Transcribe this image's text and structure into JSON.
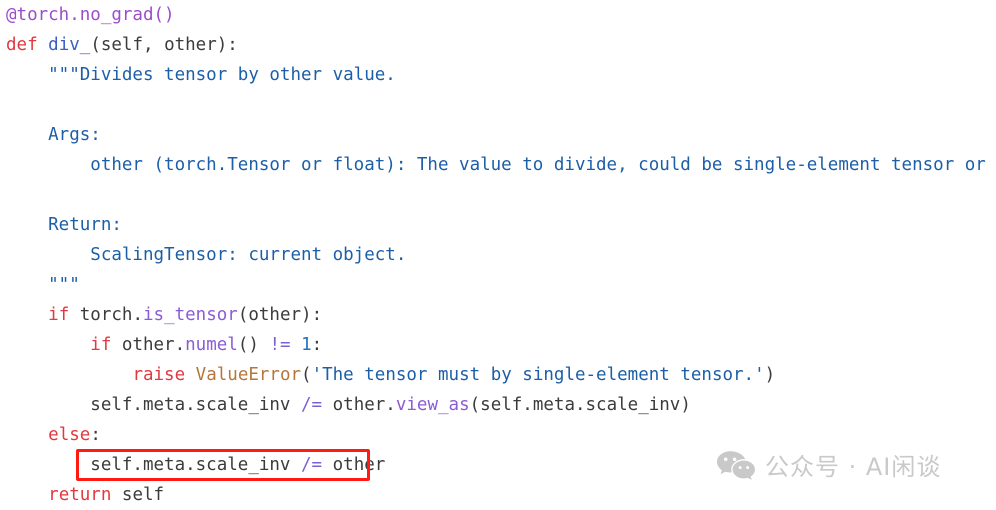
{
  "code": {
    "language": "python",
    "background_color": "#ffffff",
    "colors": {
      "plain": "#3b3b3b",
      "keyword": "#e2383f",
      "decorator": "#9b4dca",
      "function": "#3b5fc0",
      "method": "#8a5cd6",
      "operator": "#7a5fd6",
      "string": "#1c5fa8",
      "docstring": "#1c5fa8",
      "exception": "#b5763a",
      "number": "#2a6fc0"
    },
    "lines": [
      {
        "index": 1,
        "text": "@torch.no_grad()",
        "tokens": [
          {
            "t": "@torch.no_grad()",
            "c": "decorator"
          }
        ]
      },
      {
        "index": 2,
        "text": "def div_(self, other):",
        "tokens": [
          {
            "t": "def",
            "c": "keyword"
          },
          {
            "t": " ",
            "c": "plain"
          },
          {
            "t": "div_",
            "c": "func"
          },
          {
            "t": "(self, other):",
            "c": "plain"
          }
        ]
      },
      {
        "index": 3,
        "text": "    \"\"\"Divides tensor by other value.",
        "tokens": [
          {
            "t": "    \"\"\"Divides tensor by other value.",
            "c": "docstring"
          }
        ]
      },
      {
        "index": 4,
        "text": "",
        "tokens": []
      },
      {
        "index": 5,
        "text": "    Args:",
        "tokens": [
          {
            "t": "    Args:",
            "c": "docstring"
          }
        ]
      },
      {
        "index": 6,
        "text": "        other (torch.Tensor or float): The value to divide, could be single-element tensor or float.",
        "tokens": [
          {
            "t": "        other (torch.Tensor or float): The value to divide, could be single-element tensor or float.",
            "c": "docstring"
          }
        ]
      },
      {
        "index": 7,
        "text": "",
        "tokens": []
      },
      {
        "index": 8,
        "text": "    Return:",
        "tokens": [
          {
            "t": "    Return:",
            "c": "docstring"
          }
        ]
      },
      {
        "index": 9,
        "text": "        ScalingTensor: current object.",
        "tokens": [
          {
            "t": "        ScalingTensor: current object.",
            "c": "docstring"
          }
        ]
      },
      {
        "index": 10,
        "text": "    \"\"\"",
        "tokens": [
          {
            "t": "    \"\"\"",
            "c": "docstring"
          }
        ]
      },
      {
        "index": 11,
        "text": "    if torch.is_tensor(other):",
        "tokens": [
          {
            "t": "    ",
            "c": "plain"
          },
          {
            "t": "if",
            "c": "keyword"
          },
          {
            "t": " torch.",
            "c": "plain"
          },
          {
            "t": "is_tensor",
            "c": "method"
          },
          {
            "t": "(other):",
            "c": "plain"
          }
        ]
      },
      {
        "index": 12,
        "text": "        if other.numel() != 1:",
        "tokens": [
          {
            "t": "        ",
            "c": "plain"
          },
          {
            "t": "if",
            "c": "keyword"
          },
          {
            "t": " other.",
            "c": "plain"
          },
          {
            "t": "numel",
            "c": "method"
          },
          {
            "t": "() ",
            "c": "plain"
          },
          {
            "t": "!=",
            "c": "operator"
          },
          {
            "t": " ",
            "c": "plain"
          },
          {
            "t": "1",
            "c": "number"
          },
          {
            "t": ":",
            "c": "plain"
          }
        ]
      },
      {
        "index": 13,
        "text": "            raise ValueError('The tensor must by single-element tensor.')",
        "tokens": [
          {
            "t": "            ",
            "c": "plain"
          },
          {
            "t": "raise",
            "c": "keyword"
          },
          {
            "t": " ",
            "c": "plain"
          },
          {
            "t": "ValueError",
            "c": "exception"
          },
          {
            "t": "(",
            "c": "plain"
          },
          {
            "t": "'The tensor must by single-element tensor.'",
            "c": "string"
          },
          {
            "t": ")",
            "c": "plain"
          }
        ]
      },
      {
        "index": 14,
        "text": "        self.meta.scale_inv /= other.view_as(self.meta.scale_inv)",
        "tokens": [
          {
            "t": "        self.meta.scale_inv ",
            "c": "plain"
          },
          {
            "t": "/=",
            "c": "operator"
          },
          {
            "t": " other.",
            "c": "plain"
          },
          {
            "t": "view_as",
            "c": "method"
          },
          {
            "t": "(self.meta.scale_inv)",
            "c": "plain"
          }
        ]
      },
      {
        "index": 15,
        "text": "    else:",
        "tokens": [
          {
            "t": "    ",
            "c": "plain"
          },
          {
            "t": "else",
            "c": "keyword"
          },
          {
            "t": ":",
            "c": "plain"
          }
        ]
      },
      {
        "index": 16,
        "text": "        self.meta.scale_inv /= other",
        "tokens": [
          {
            "t": "        self.meta.scale_inv ",
            "c": "plain"
          },
          {
            "t": "/=",
            "c": "operator"
          },
          {
            "t": " other",
            "c": "plain"
          }
        ]
      },
      {
        "index": 17,
        "text": "    return self",
        "tokens": [
          {
            "t": "    ",
            "c": "plain"
          },
          {
            "t": "return",
            "c": "keyword"
          },
          {
            "t": " self",
            "c": "plain"
          }
        ]
      }
    ]
  },
  "annotation": {
    "type": "rectangle-highlight",
    "color": "#ff1a12",
    "target_line_index": 16,
    "target_text": "self.meta.scale_inv /= other"
  },
  "watermark": {
    "icon": "wechat-icon",
    "text": "公众号 · AI闲谈",
    "color": "#c9c9c9"
  }
}
